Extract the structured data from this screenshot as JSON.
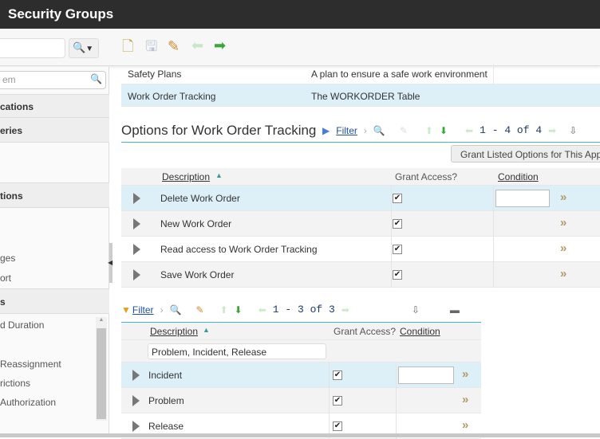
{
  "title": "Security Groups",
  "toolbar": {
    "icons": [
      "new-icon",
      "save-icon",
      "clear-icon",
      "previous-icon",
      "next-icon"
    ]
  },
  "sidebar": {
    "search_placeholder": "em",
    "sections": [
      {
        "label": "cations"
      },
      {
        "label": "eries"
      },
      {
        "label": "tions"
      },
      {
        "label": "s"
      }
    ],
    "items_mid": [
      "ges",
      "ort"
    ],
    "items_bottom": [
      "d Duration",
      "Reassignment",
      "rictions",
      "Authorization"
    ]
  },
  "apps": [
    {
      "name": "Safety Plans",
      "description": "A plan to ensure a safe work environment"
    },
    {
      "name": "Work Order Tracking",
      "description": "The WORKORDER Table"
    }
  ],
  "options": {
    "heading": "Options for Work Order Tracking",
    "filter": "Filter",
    "pager": "1 - 4 of 4",
    "grant_button": "Grant Listed Options for This Applica",
    "headers": {
      "description": "Description",
      "grant": "Grant Access?",
      "condition": "Condition"
    },
    "rows": [
      {
        "description": "Delete Work Order",
        "grant": true
      },
      {
        "description": "New Work Order",
        "grant": true
      },
      {
        "description": "Read access to Work Order Tracking",
        "grant": true
      },
      {
        "description": "Save Work Order",
        "grant": true
      }
    ]
  },
  "sigoptions": {
    "filter": "Filter",
    "pager": "1 - 3 of 3",
    "headers": {
      "description": "Description",
      "grant": "Grant Access?",
      "condition": "Condition"
    },
    "filter_value": "Problem, Incident, Release",
    "rows": [
      {
        "description": "Incident",
        "grant": true
      },
      {
        "description": "Problem",
        "grant": true
      },
      {
        "description": "Release",
        "grant": true
      }
    ]
  }
}
